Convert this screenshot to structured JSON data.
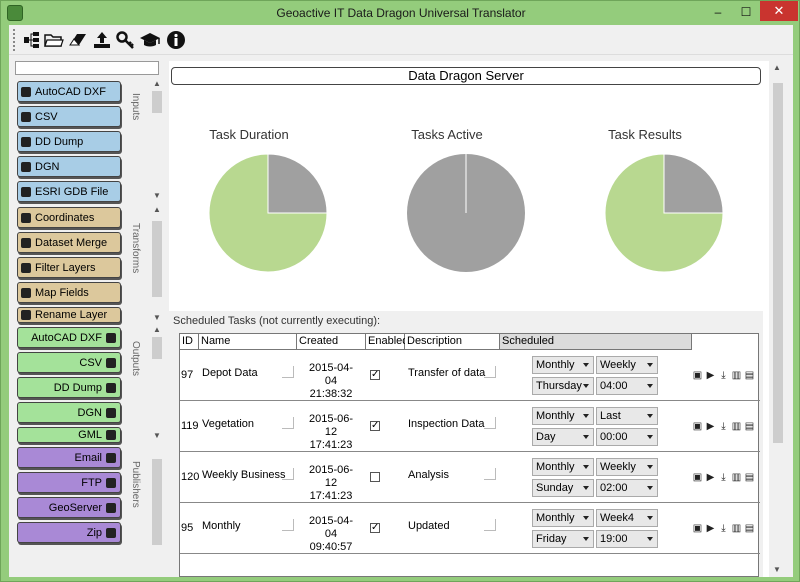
{
  "window": {
    "title": "Geoactive IT Data Dragon Universal Translator"
  },
  "toolbar": {
    "icons": [
      "hierarchy-icon",
      "open-folder-icon",
      "eraser-icon",
      "upload-icon",
      "key-icon",
      "graduation-cap-icon",
      "info-icon"
    ]
  },
  "panels": {
    "inputs": {
      "label": "Inputs",
      "items": [
        "AutoCAD DXF",
        "CSV",
        "DD Dump",
        "DGN",
        "ESRI GDB File"
      ]
    },
    "transforms": {
      "label": "Transforms",
      "items": [
        "Coordinates",
        "Dataset Merge",
        "Filter Layers",
        "Map Fields",
        "Rename Layer"
      ]
    },
    "outputs": {
      "label": "Outputs",
      "items": [
        "AutoCAD DXF",
        "CSV",
        "DD Dump",
        "DGN",
        "GML"
      ]
    },
    "publishers": {
      "label": "Publishers",
      "items": [
        "Email",
        "FTP",
        "GeoServer",
        "Zip"
      ]
    }
  },
  "main": {
    "header": "Data Dragon Server"
  },
  "charts": [
    {
      "title": "Task Duration",
      "slices": [
        {
          "value": 75,
          "color": "#b8d890"
        },
        {
          "value": 25,
          "color": "#a0a0a0"
        }
      ]
    },
    {
      "title": "Tasks Active",
      "slices": [
        {
          "value": 100,
          "color": "#a0a0a0"
        }
      ]
    },
    {
      "title": "Task Results",
      "slices": [
        {
          "value": 75,
          "color": "#b8d890"
        },
        {
          "value": 25,
          "color": "#a0a0a0"
        }
      ]
    }
  ],
  "scheduled": {
    "title": "Scheduled Tasks (not currently executing):",
    "headers": [
      "ID",
      "Name",
      "Created",
      "Enabled",
      "Description",
      "Scheduled"
    ],
    "rows": [
      {
        "id": "97",
        "name": "Depot Data",
        "created_date": "2015-04-04",
        "created_time": "21:38:32",
        "enabled": true,
        "description": "Transfer of data",
        "freq": "Monthly",
        "period": "Weekly",
        "day": "Thursday",
        "time": "04:00"
      },
      {
        "id": "119",
        "name": "Vegetation",
        "created_date": "2015-06-12",
        "created_time": "17:41:23",
        "enabled": true,
        "description": "Inspection Data",
        "freq": "Monthly",
        "period": "Last",
        "day": "Day",
        "time": "00:00"
      },
      {
        "id": "120",
        "name": "Weekly Business",
        "created_date": "2015-06-12",
        "created_time": "17:41:23",
        "enabled": false,
        "description": "Analysis",
        "freq": "Monthly",
        "period": "Weekly",
        "day": "Sunday",
        "time": "02:00"
      },
      {
        "id": "95",
        "name": "Monthly",
        "created_date": "2015-04-04",
        "created_time": "09:40:57",
        "enabled": true,
        "description": "Updated",
        "freq": "Monthly",
        "period": "Week4",
        "day": "Friday",
        "time": "19:00"
      }
    ]
  }
}
